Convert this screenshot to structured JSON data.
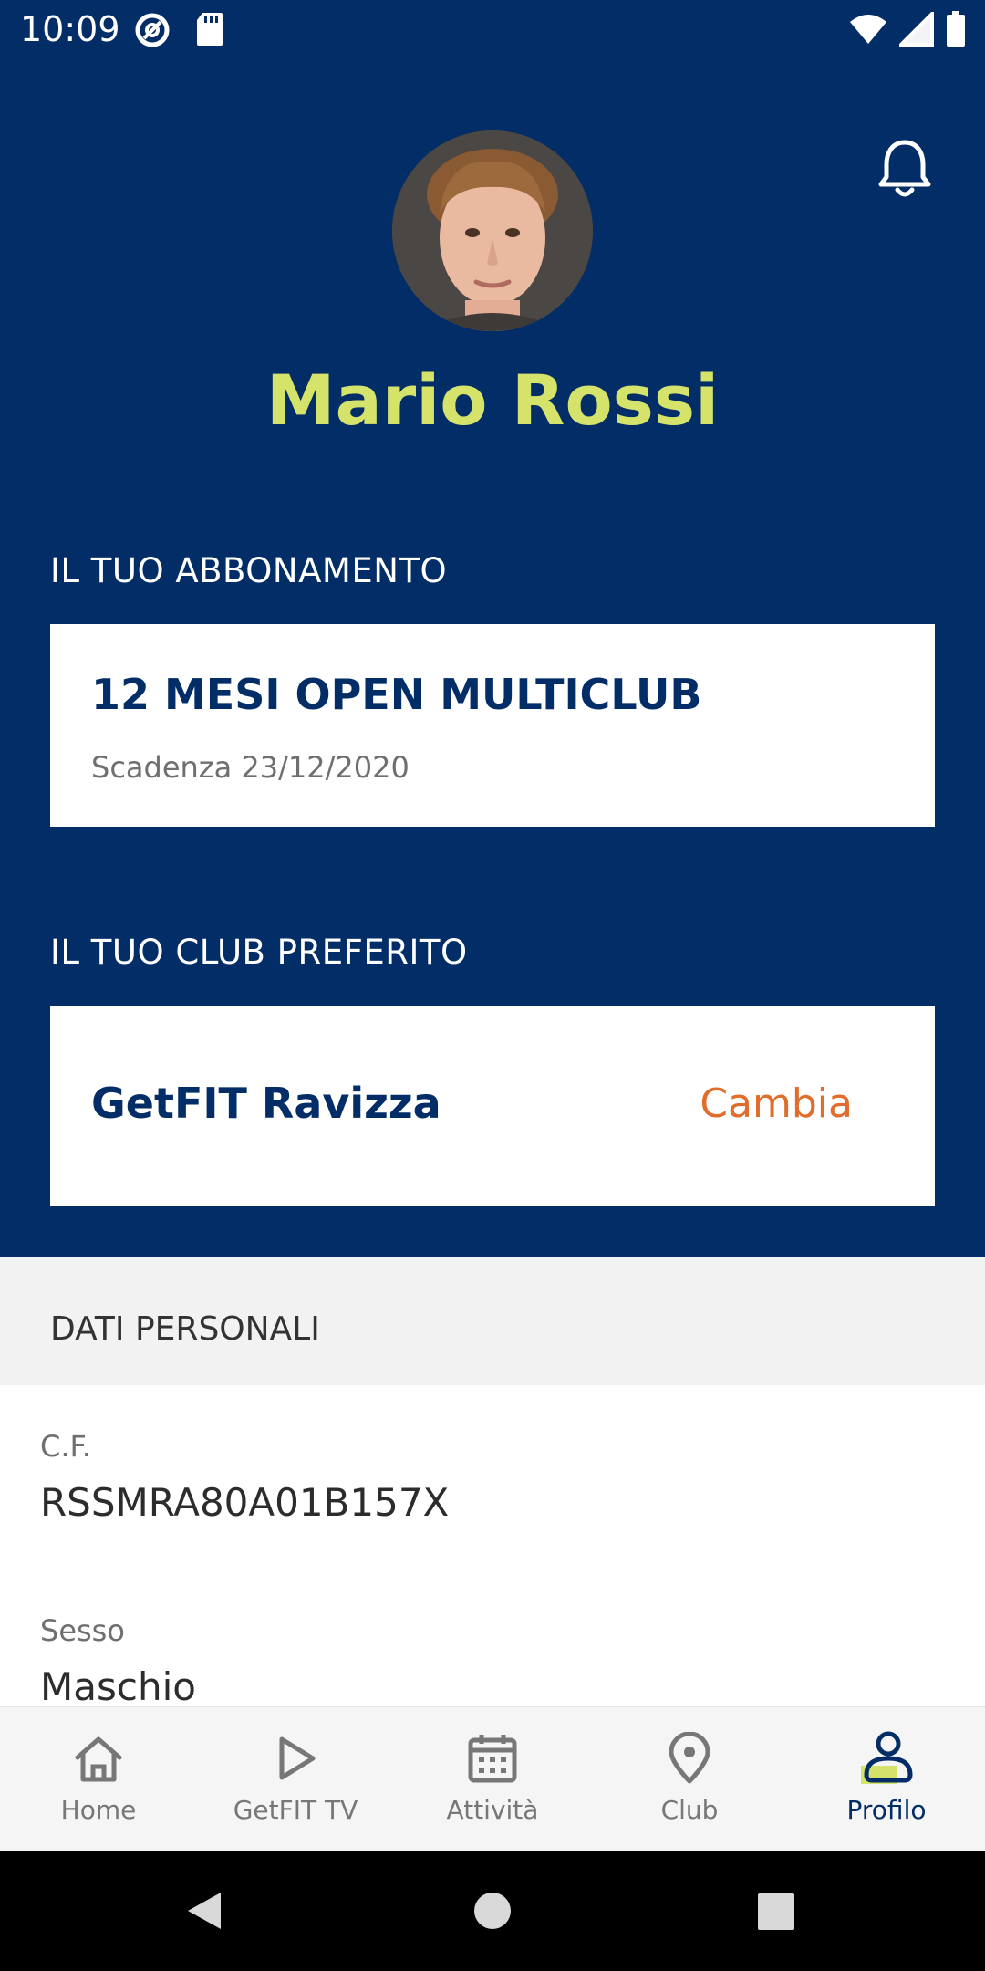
{
  "status_bar": {
    "time": "10:09",
    "left_icons": [
      "at-sign-icon",
      "sd-card-icon"
    ],
    "right_icons": [
      "wifi-icon",
      "signal-icon",
      "battery-icon"
    ]
  },
  "profile": {
    "name": "Mario Rossi",
    "avatar": "user-avatar"
  },
  "subscription": {
    "section_title": "IL TUO ABBONAMENTO",
    "plan_name": "12 MESI OPEN MULTICLUB",
    "expiry": "Scadenza 23/12/2020"
  },
  "favorite_club": {
    "section_title": "IL TUO CLUB PREFERITO",
    "club_name": "GetFIT Ravizza",
    "change_label": "Cambia"
  },
  "personal": {
    "section_title": "DATI PERSONALI",
    "fields": [
      {
        "label": "C.F.",
        "value": "RSSMRA80A01B157X"
      },
      {
        "label": "Sesso",
        "value": "Maschio"
      }
    ]
  },
  "bottom_nav": {
    "items": [
      {
        "label": "Home",
        "icon": "home-icon"
      },
      {
        "label": "GetFIT TV",
        "icon": "play-icon"
      },
      {
        "label": "Attività",
        "icon": "calendar-icon"
      },
      {
        "label": "Club",
        "icon": "location-pin-icon"
      },
      {
        "label": "Profilo",
        "icon": "profile-icon",
        "active": true
      }
    ]
  },
  "colors": {
    "primary": "#032d66",
    "accent_name": "#d6e36b",
    "link": "#e06d2b"
  }
}
